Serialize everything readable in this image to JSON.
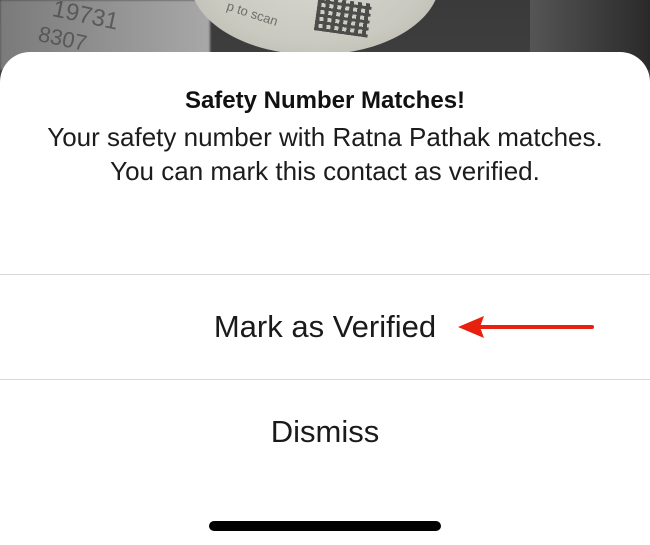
{
  "background": {
    "numbers_line1": "19731",
    "numbers_line2": "8307",
    "scan_hint": "p to scan"
  },
  "dialog": {
    "title": "Safety Number Matches!",
    "message": "Your safety number with Ratna Pathak matches. You can mark this contact as verified.",
    "primary_action": "Mark as Verified",
    "secondary_action": "Dismiss"
  },
  "annotation": {
    "arrow_color": "#e8200e",
    "arrow_icon": "arrow-left-icon"
  }
}
